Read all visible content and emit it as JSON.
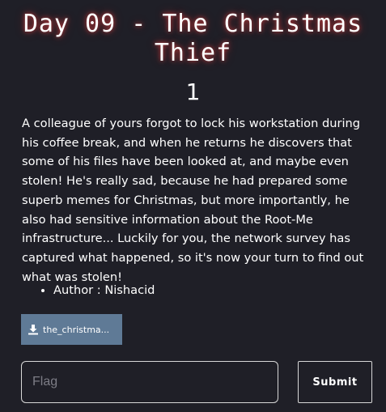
{
  "challenge": {
    "title": "Day 09 - The Christmas Thief",
    "points": "1",
    "description": "A colleague of yours forgot to lock his workstation during his coffee break, and when he returns he discovers that some of his files have been looked at, and maybe even stolen! He's really sad, because he had prepared some superb memes for Christmas, but more importantly, he also had sensitive information about the Root-Me infrastructure... Luckily for you, the network survey has captured what happened, so it's now your turn to find out what was stolen!",
    "author": "Author : Nishacid"
  },
  "file": {
    "label": "the_christma...",
    "icon": "download-icon"
  },
  "flag_form": {
    "placeholder": "Flag",
    "value": "",
    "submit_label": "Submit"
  },
  "colors": {
    "background": "#1f1f27",
    "title_glow": "#ff4646",
    "file_button": "#5f7a96",
    "input_border": "#d8d8d8"
  }
}
